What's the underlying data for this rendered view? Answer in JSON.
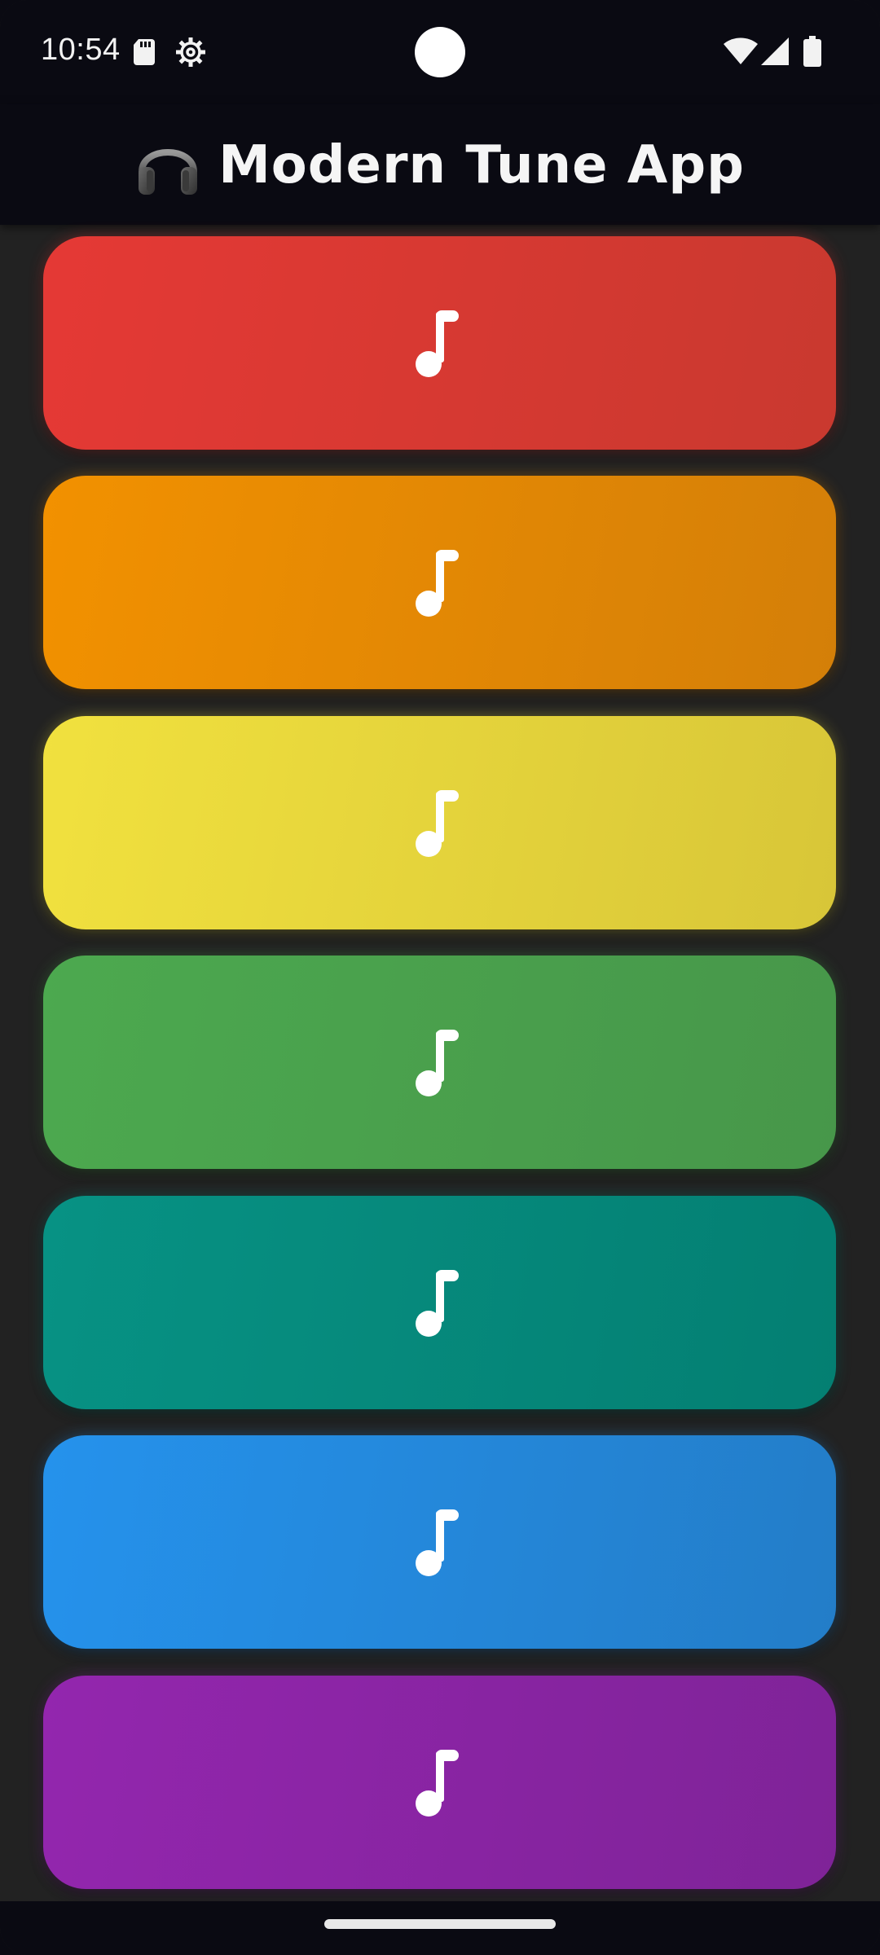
{
  "status_bar": {
    "time": "10:54",
    "icons": [
      "sd-card-icon",
      "gear-icon",
      "camera-cutout",
      "wifi-icon",
      "signal-icon",
      "battery-icon"
    ]
  },
  "app_bar": {
    "icon": "headphones-icon",
    "title": "Modern Tune App"
  },
  "tiles": [
    {
      "name": "red",
      "color_start": "#E53935",
      "color_end": "#C9392F",
      "glow": "#E53935",
      "icon": "music-note-icon"
    },
    {
      "name": "orange",
      "color_start": "#F29100",
      "color_end": "#D47F08",
      "glow": "#F29100",
      "icon": "music-note-icon"
    },
    {
      "name": "yellow",
      "color_start": "#F1E13E",
      "color_end": "#D8C638",
      "glow": "#F1E13E",
      "icon": "music-note-icon"
    },
    {
      "name": "green",
      "color_start": "#4CA94F",
      "color_end": "#47974A",
      "glow": "#4CA94F",
      "icon": "music-note-icon"
    },
    {
      "name": "teal",
      "color_start": "#079284",
      "color_end": "#047F72",
      "glow": "#079284",
      "icon": "music-note-icon"
    },
    {
      "name": "blue",
      "color_start": "#2592EC",
      "color_end": "#237DC8",
      "glow": "#2592EC",
      "icon": "music-note-icon"
    },
    {
      "name": "purple",
      "color_start": "#9326AE",
      "color_end": "#7F2398",
      "glow": "#9326AE",
      "icon": "music-note-icon"
    }
  ],
  "navigation": {
    "home_handle": "home-gesture-bar"
  }
}
